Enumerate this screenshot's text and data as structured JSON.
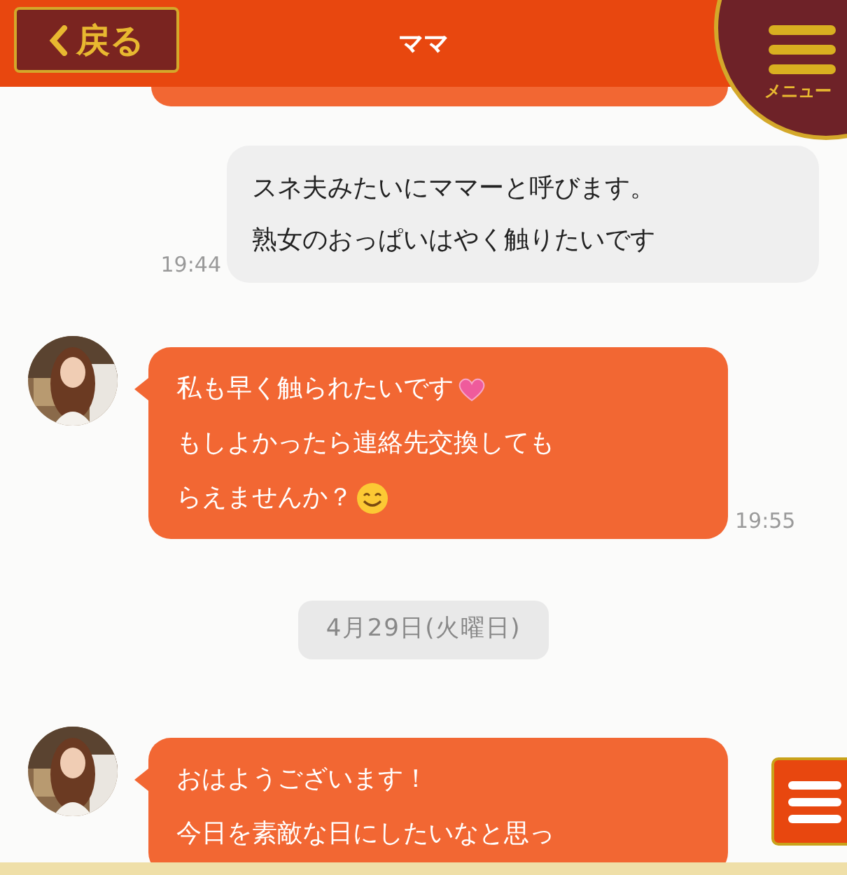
{
  "header": {
    "back_label": "戻る",
    "title": "ママ",
    "menu_label": "メニュー"
  },
  "messages": [
    {
      "kind": "partial"
    },
    {
      "kind": "sent",
      "lines": [
        {
          "kind": "plain",
          "text": "スネ夫みたいにママーと呼びます。"
        },
        {
          "kind": "plain",
          "text": "熟女のおっぱいはやく触りたいです"
        }
      ],
      "time": "19:44"
    },
    {
      "kind": "received",
      "lines": [
        {
          "kind": "heart",
          "text": "私も早く触られたいです"
        },
        {
          "kind": "plain",
          "text": "もしよかったら連絡先交換しても"
        },
        {
          "kind": "smile",
          "text": "らえませんか？"
        }
      ],
      "time": "19:55"
    },
    {
      "kind": "date",
      "text": "4月29日(火曜日)"
    },
    {
      "kind": "received",
      "lines": [
        {
          "kind": "plain",
          "text": "おはようございます！"
        },
        {
          "kind": "plain",
          "text": "今日を素敵な日にしたいなと思っ"
        }
      ]
    }
  ]
}
